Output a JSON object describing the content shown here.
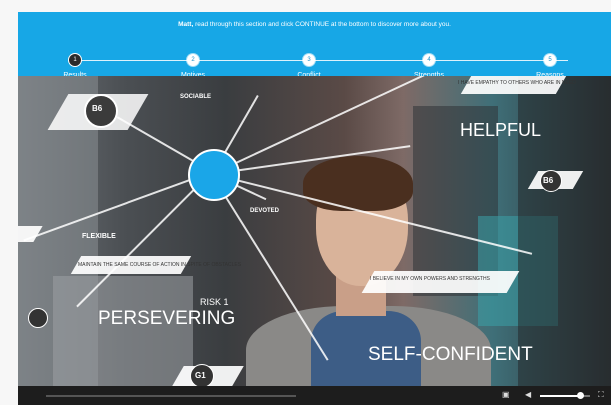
{
  "header": {
    "user_name": "Matt,",
    "instruction": " read through this section and click CONTINUE at the bottom to discover more about you."
  },
  "steps": [
    {
      "number": "1",
      "label": "Results",
      "active": true
    },
    {
      "number": "2",
      "label": "Motives",
      "active": false
    },
    {
      "number": "3",
      "label": "Conflict",
      "active": false
    },
    {
      "number": "4",
      "label": "Strengths",
      "active": false
    },
    {
      "number": "5",
      "label": "Reasons",
      "active": false
    }
  ],
  "video": {
    "traits": {
      "helpful": "HELPFUL",
      "persevering": "PERSEVERING",
      "self_confident": "SELF-CONFIDENT",
      "sociable": "SOCIABLE",
      "devoted": "DEVOTED",
      "flexible": "FLEXIBLE",
      "risk": "RISK 1"
    },
    "badges": {
      "b6_left": "B6",
      "b6_right": "B6",
      "g1": "G1"
    },
    "captions": {
      "helpful_desc": "I HAVE EMPATHY TO OTHERS WHO ARE IN NEED",
      "persevering_desc": "MAINTAIN THE SAME COURSE OF ACTION IN SPITE OF OBSTACLES",
      "self_confident_desc": "I BELIEVE IN MY OWN POWERS AND STRENGTHS"
    }
  },
  "controls": {
    "progress_fraction": 0,
    "volume_fraction": 0.8,
    "icons": [
      "cc-icon",
      "volume-icon",
      "fullscreen-icon"
    ]
  },
  "colors": {
    "header_bg": "#17a7e6",
    "node": "#1aa6e8",
    "controls_bg": "#1d1d1d"
  }
}
